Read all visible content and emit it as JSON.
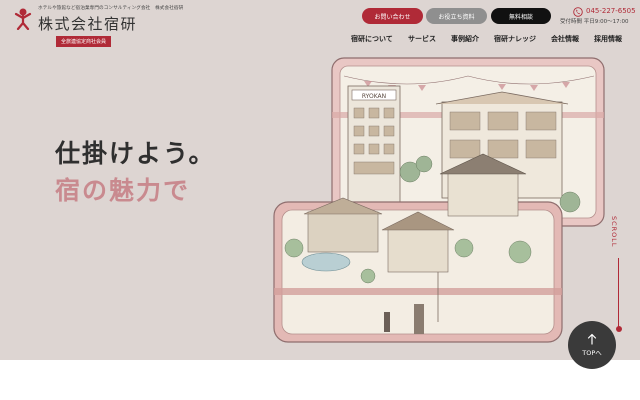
{
  "header": {
    "tagline": "ホテルや旅館など宿泊業専門のコンサルティング会社　株式会社宿研",
    "company_name": "株式会社宿研",
    "member_badge": "全旅連協定商社会員",
    "buttons": {
      "contact": "お問い合わせ",
      "documents": "お役立ち資料",
      "consultation": "無料相談"
    },
    "phone": "045-227-6505",
    "hours": "受付時間 平日9:00～17:00",
    "nav": [
      "宿研について",
      "サービス",
      "事例紹介",
      "宿研ナレッジ",
      "会社情報",
      "採用情報"
    ]
  },
  "hero": {
    "catch_line1": "仕掛けよう。",
    "catch_line2": "宿の魅力で",
    "illustration_sign": "RYOKAN",
    "scroll_label": "SCROLL"
  },
  "top_button": {
    "label": "TOPへ"
  },
  "colors": {
    "accent": "#b02a37",
    "hero_background": "#ddd5d2",
    "catch_pink": "#c98a8f",
    "top_button": "#3a3a3a"
  },
  "icons": [
    "logo-mascot-icon",
    "phone-icon",
    "arrow-up-icon"
  ]
}
